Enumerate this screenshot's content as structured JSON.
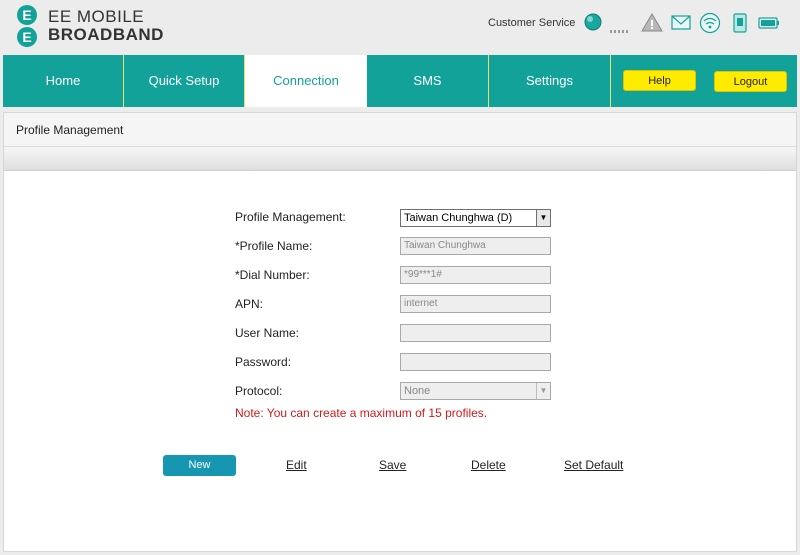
{
  "brand": {
    "line1": "EE MOBILE",
    "line2": "BROADBAND",
    "colors": {
      "primary": "#12a29a",
      "accent": "#ffeb00",
      "button": "#1796b2",
      "note": "#d11a1a"
    }
  },
  "header": {
    "customer_service": "Customer Service",
    "status_icons": [
      "connection-status-icon",
      "signal-strength-icon",
      "warning-icon",
      "message-icon",
      "wifi-icon",
      "sim-icon",
      "battery-icon"
    ]
  },
  "nav": {
    "tabs": [
      {
        "label": "Home"
      },
      {
        "label": "Quick Setup"
      },
      {
        "label": "Connection",
        "active": true
      },
      {
        "label": "SMS"
      },
      {
        "label": "Settings"
      }
    ],
    "help_label": "Help",
    "logout_label": "Logout"
  },
  "page": {
    "title": "Profile Management",
    "form": {
      "profile_management_label": "Profile Management:",
      "profile_management_value": "Taiwan Chunghwa (D)",
      "profile_name_label": "*Profile Name:",
      "profile_name_value": "Taiwan Chunghwa",
      "dial_number_label": "*Dial Number:",
      "dial_number_value": "*99***1#",
      "apn_label": "APN:",
      "apn_value": "internet",
      "user_name_label": "User Name:",
      "user_name_value": "",
      "password_label": "Password:",
      "password_value": "",
      "protocol_label": "Protocol:",
      "protocol_value": "None"
    },
    "note": "Note: You can create a maximum of 15 profiles.",
    "actions": {
      "new_label": "New",
      "edit_label": "Edit",
      "save_label": "Save",
      "delete_label": "Delete",
      "set_default_label": "Set Default"
    }
  }
}
